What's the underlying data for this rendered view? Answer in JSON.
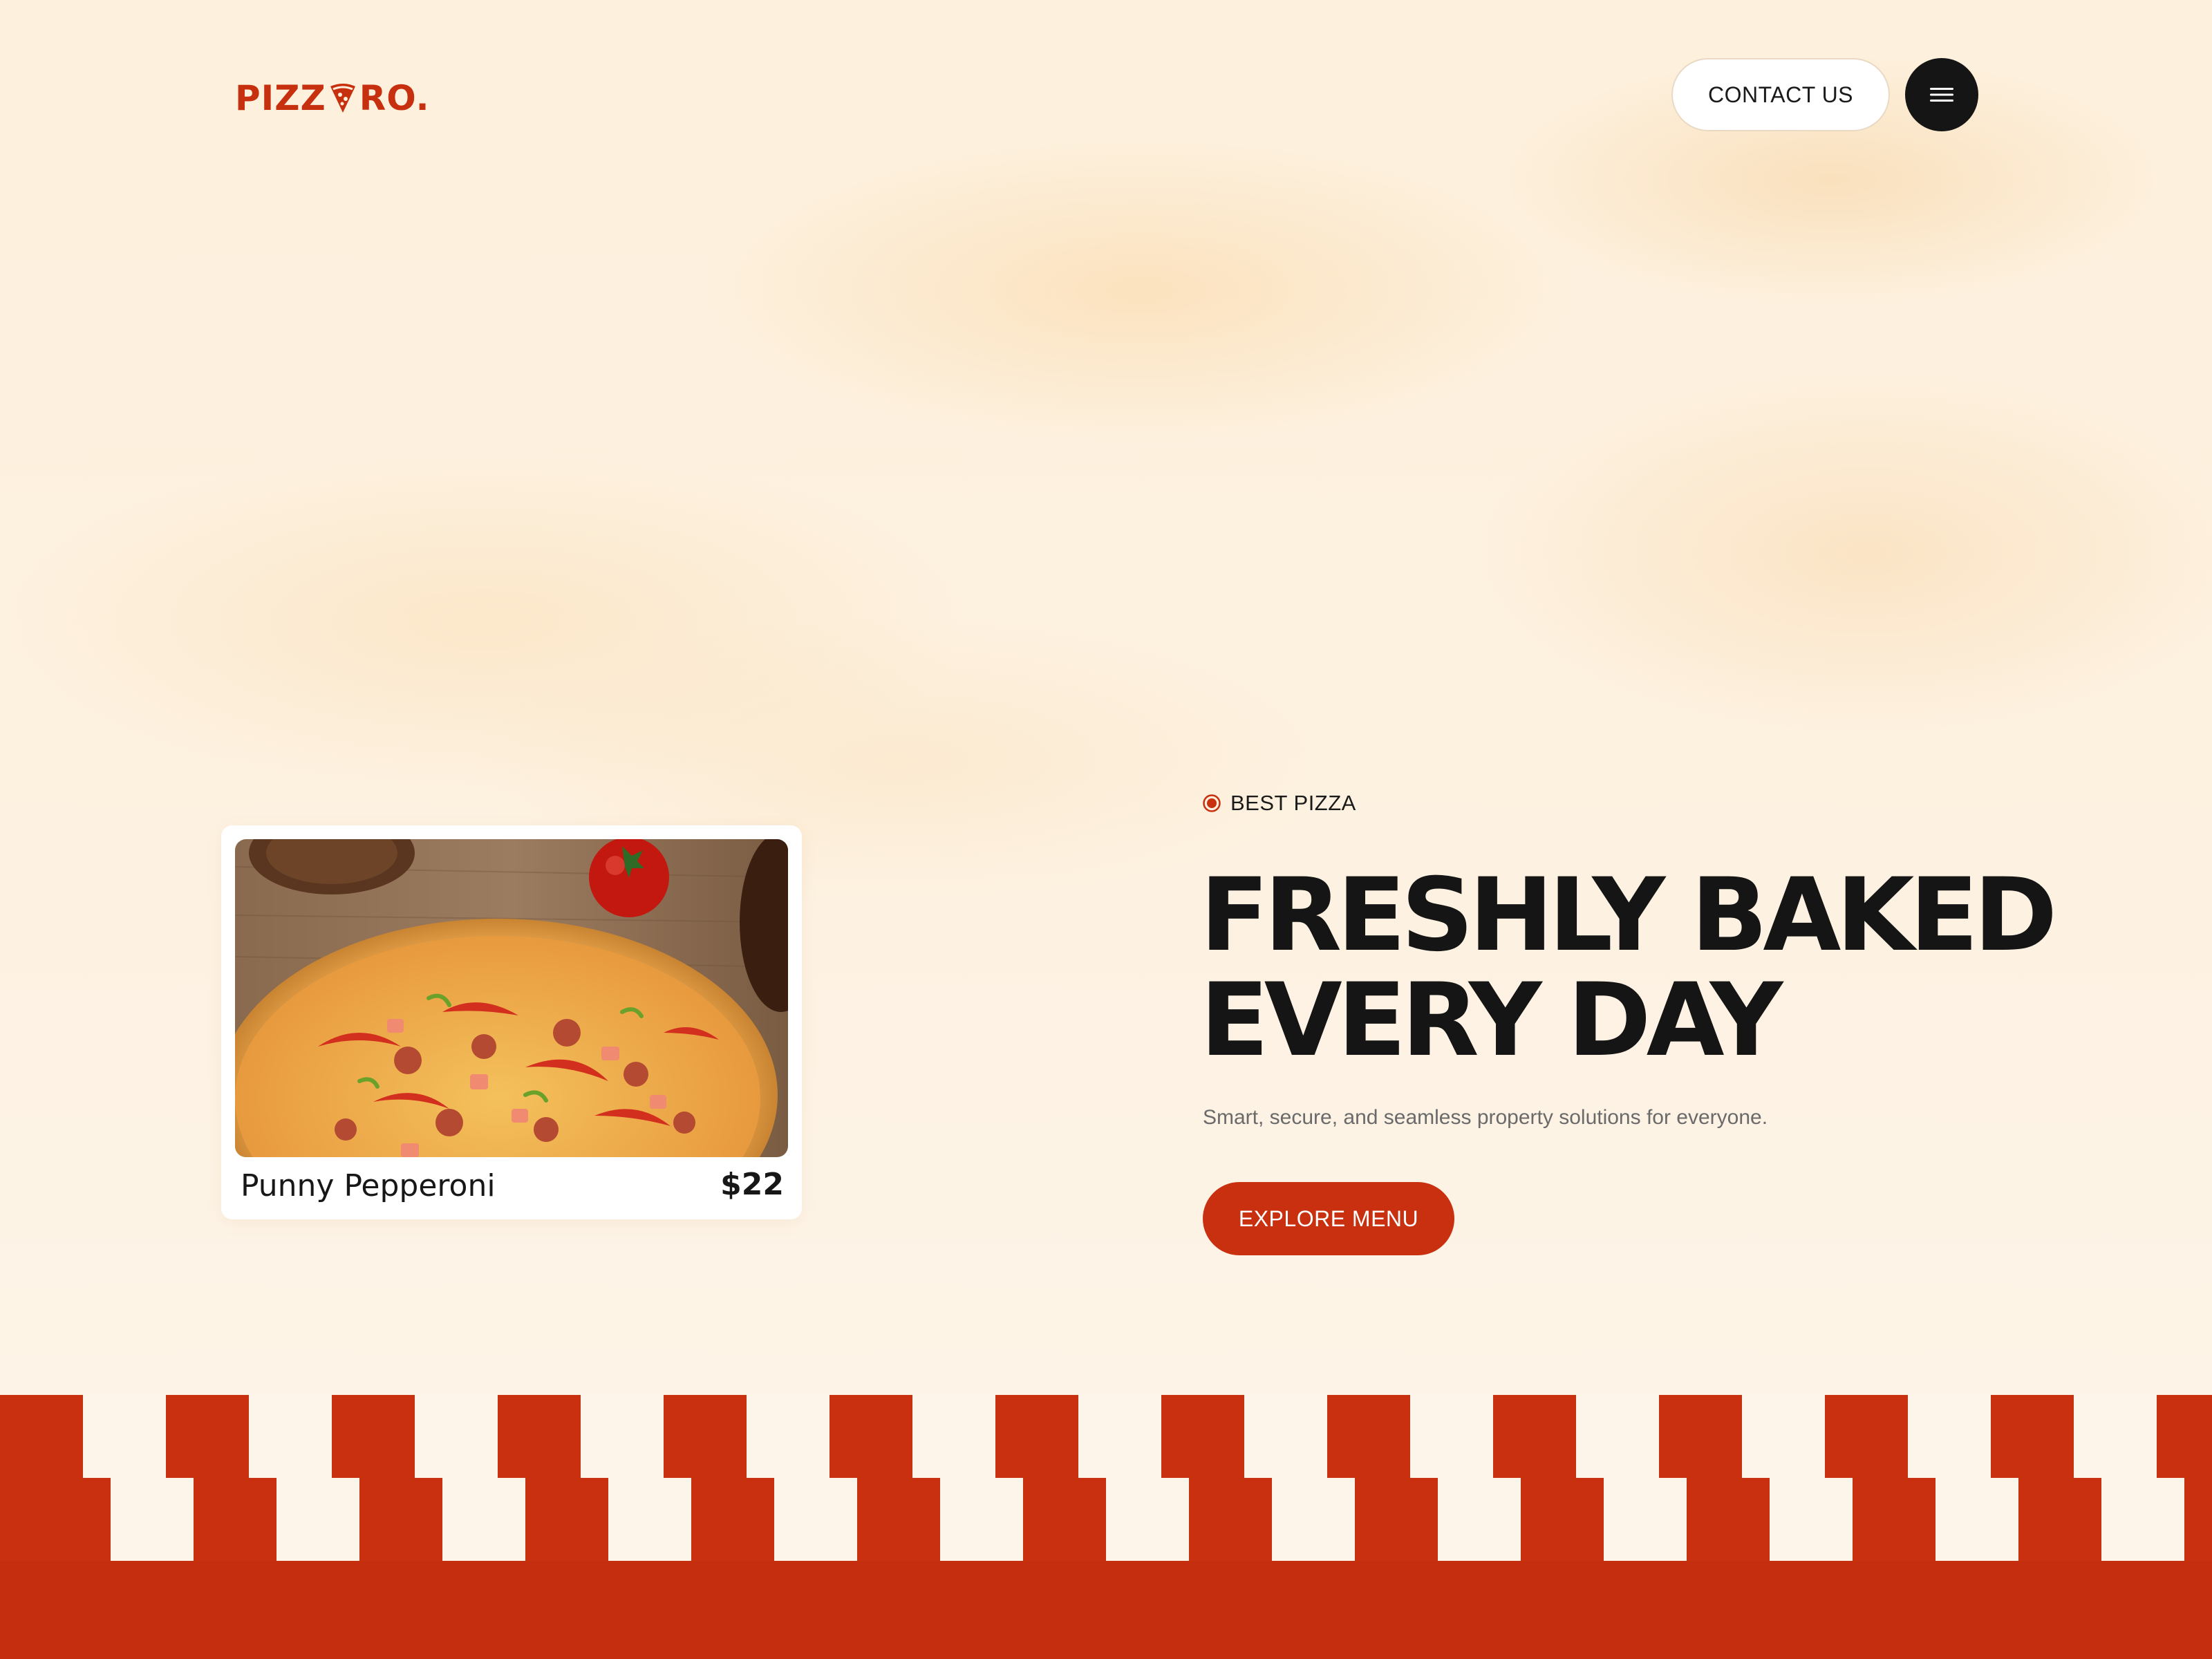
{
  "header": {
    "logo_left": "PIZZ",
    "logo_right": "RO.",
    "contact_label": "CONTACT US",
    "menu_icon": "hamburger-menu-icon"
  },
  "product_card": {
    "name": "Punny Pepperoni",
    "price": "$22",
    "image": "pepperoni-pizza-photo"
  },
  "hero": {
    "tag": "BEST PIZZA",
    "headline_line1": "FRESHLY BAKED",
    "headline_line2": "EVERY DAY",
    "subtext": "Smart, secure, and seamless property solutions for everyone.",
    "cta_label": "EXPLORE MENU"
  },
  "colors": {
    "brand_red": "#c8300f",
    "dark": "#151515",
    "cream": "#fdf3e6"
  }
}
